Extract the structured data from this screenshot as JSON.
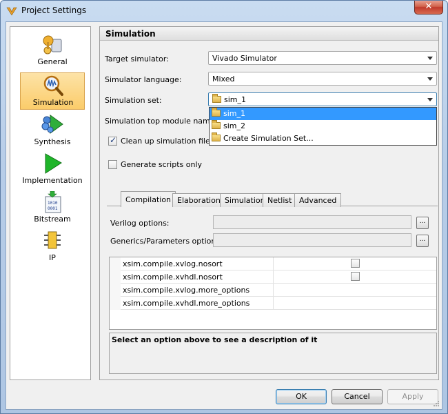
{
  "window": {
    "title": "Project Settings",
    "close_label": "✕"
  },
  "sidebar": {
    "items": [
      {
        "label": "General",
        "icon": "general-icon",
        "selected": false
      },
      {
        "label": "Simulation",
        "icon": "simulation-icon",
        "selected": true
      },
      {
        "label": "Synthesis",
        "icon": "synthesis-icon",
        "selected": false
      },
      {
        "label": "Implementation",
        "icon": "implementation-icon",
        "selected": false
      },
      {
        "label": "Bitstream",
        "icon": "bitstream-icon",
        "selected": false
      },
      {
        "label": "IP",
        "icon": "ip-icon",
        "selected": false
      }
    ]
  },
  "panel": {
    "title": "Simulation",
    "target_simulator": {
      "label": "Target simulator:",
      "value": "Vivado Simulator"
    },
    "simulator_language": {
      "label": "Simulator language:",
      "value": "Mixed"
    },
    "simulation_set": {
      "label": "Simulation set:",
      "value": "sim_1",
      "options": [
        "sim_1",
        "sim_2",
        "Create Simulation Set..."
      ],
      "highlighted_index": 0
    },
    "top_module": {
      "label": "Simulation top module name:"
    },
    "cleanup": {
      "label": "Clean up simulation files",
      "checked": true
    },
    "generate_scripts": {
      "label": "Generate scripts only",
      "checked": false
    },
    "tabs": [
      {
        "label": "Compilation",
        "active": true
      },
      {
        "label": "Elaboration",
        "active": false
      },
      {
        "label": "Simulation",
        "active": false
      },
      {
        "label": "Netlist",
        "active": false
      },
      {
        "label": "Advanced",
        "active": false
      }
    ],
    "verilog_options": {
      "label": "Verilog options:",
      "button": "..."
    },
    "generics_options": {
      "label": "Generics/Parameters options:",
      "button": "..."
    },
    "properties": [
      {
        "name": "xsim.compile.xvlog.nosort",
        "type": "checkbox",
        "checked": false
      },
      {
        "name": "xsim.compile.xvhdl.nosort",
        "type": "checkbox",
        "checked": false
      },
      {
        "name": "xsim.compile.xvlog.more_options",
        "type": "text",
        "value": ""
      },
      {
        "name": "xsim.compile.xvhdl.more_options",
        "type": "text",
        "value": ""
      }
    ],
    "description": "Select an option above to see a description of it"
  },
  "buttons": {
    "ok": "OK",
    "cancel": "Cancel",
    "apply": "Apply"
  },
  "colors": {
    "selection_highlight": "#3399ff",
    "sidebar_selected": "#fbcc6a"
  }
}
